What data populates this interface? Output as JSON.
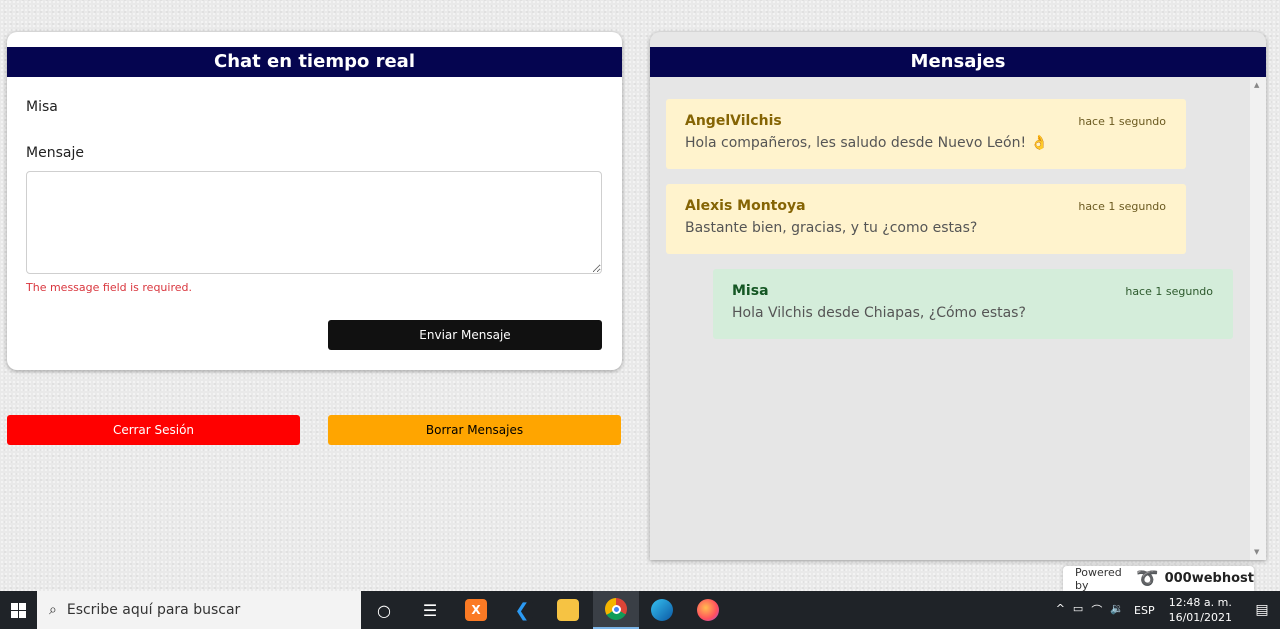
{
  "chat_card": {
    "title": "Chat en tiempo real",
    "name_label": "Misa",
    "message_label": "Mensaje",
    "message_value": "",
    "error_text": "The message field is required.",
    "send_label": "Enviar Mensaje"
  },
  "actions": {
    "logout_label": "Cerrar Sesión",
    "clear_label": "Borrar Mensajes"
  },
  "messages_card": {
    "title": "Mensajes",
    "messages": [
      {
        "author": "AngelVilchis",
        "time": "hace 1 segundo",
        "text": "Hola compañeros, les saludo desde Nuevo León! 👌",
        "style": "yellow"
      },
      {
        "author": "Alexis Montoya",
        "time": "hace 1 segundo",
        "text": "Bastante bien, gracias, y tu ¿como estas?",
        "style": "yellow"
      },
      {
        "author": "Misa",
        "time": "hace 1 segundo",
        "text": "Hola Vilchis desde Chiapas, ¿Cómo estas?",
        "style": "green"
      }
    ]
  },
  "powered": {
    "prefix": "Powered by",
    "brand": "000webhost"
  },
  "taskbar": {
    "search_placeholder": "Escribe aquí para buscar",
    "lang": "ESP",
    "time": "12:48 a. m.",
    "date": "16/01/2021",
    "apps": [
      "cortana-icon",
      "task-view-icon",
      "xampp-icon",
      "vscode-icon",
      "file-explorer-icon",
      "chrome-icon",
      "edge-icon",
      "firefox-icon"
    ]
  },
  "colors": {
    "header": "#050550",
    "logout": "#ff0000",
    "clear": "#ffa500",
    "send": "#111111"
  }
}
